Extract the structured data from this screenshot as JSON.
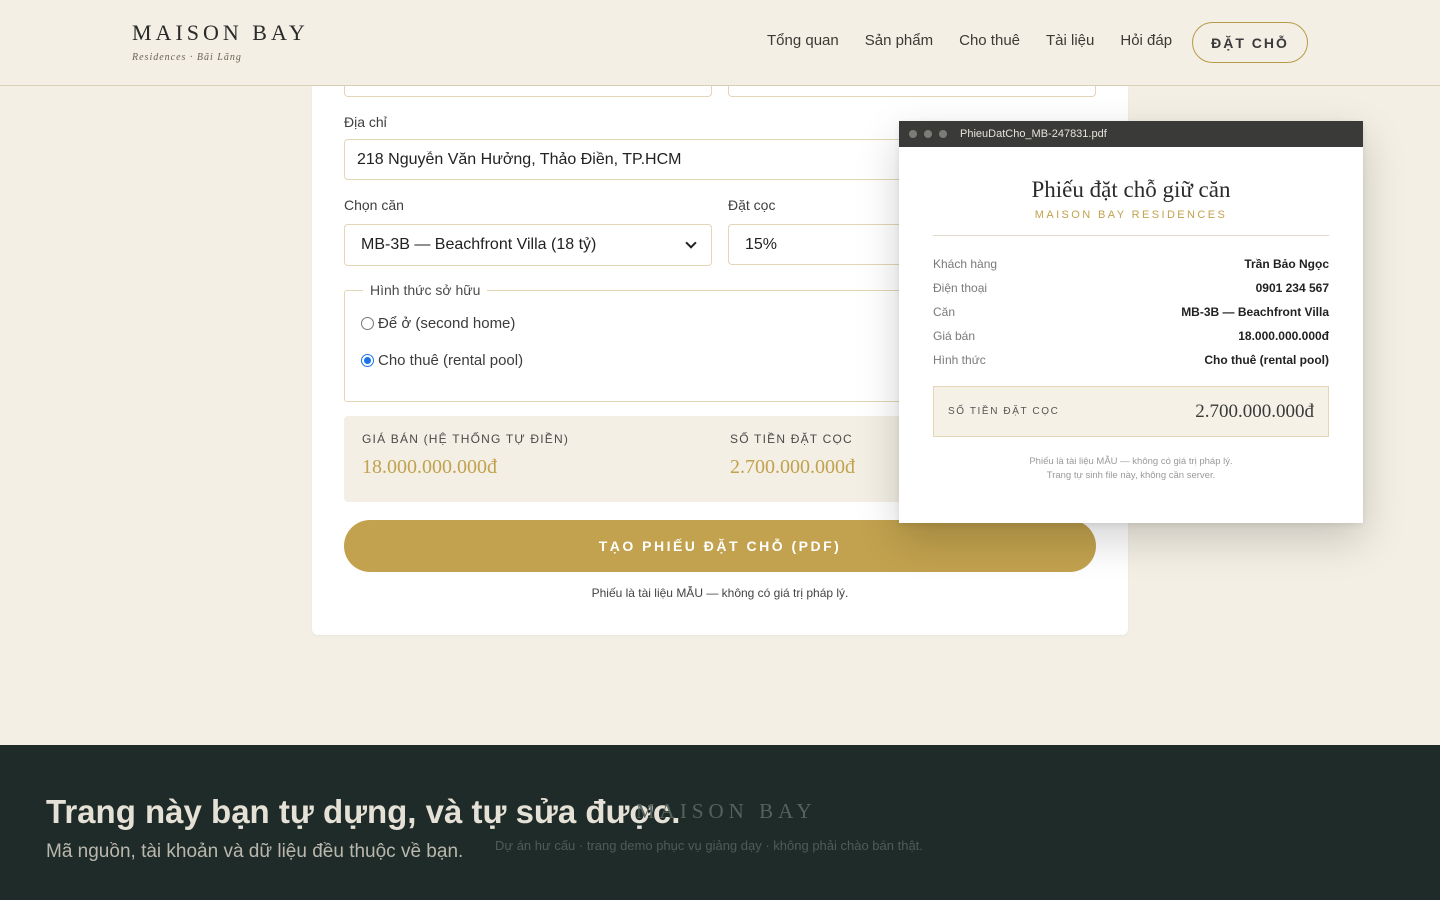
{
  "header": {
    "brand_name": "MAISON BAY",
    "brand_sub": "Residences · Bãi Lãng",
    "nav": [
      "Tổng quan",
      "Sản phẩm",
      "Cho thuê",
      "Tài liệu",
      "Hỏi đáp"
    ],
    "cta_label": "ĐẶT CHỖ"
  },
  "form": {
    "address_label": "Địa chỉ",
    "address_value": "218 Nguyễn Văn Hưởng, Thảo Điền, TP.HCM",
    "unit_label": "Chọn căn",
    "unit_value": "MB-3B — Beachfront Villa (18 tỷ)",
    "deposit_label": "Đặt cọc",
    "deposit_value": "15%",
    "ownership_legend": "Hình thức sở hữu",
    "ownership_options": [
      {
        "label": "Để ở (second home)",
        "checked": false
      },
      {
        "label": "Cho thuê (rental pool)",
        "checked": true
      }
    ],
    "price_label": "GIÁ BÁN (HỆ THỐNG TỰ ĐIỀN)",
    "price_value": "18.000.000.000đ",
    "deposit_amount_label": "SỐ TIỀN ĐẶT CỌC",
    "deposit_amount_value": "2.700.000.000đ",
    "submit_label": "TẠO PHIẾU ĐẶT CHỖ (PDF)",
    "disclaimer": "Phiếu là tài liệu MẪU — không có giá trị pháp lý."
  },
  "pdf": {
    "filename": "PhieuDatCho_MB-247831.pdf",
    "title": "Phiếu đặt chỗ giữ căn",
    "brand": "MAISON BAY RESIDENCES",
    "rows": [
      {
        "k": "Khách hàng",
        "v": "Trần Bảo Ngọc"
      },
      {
        "k": "Điện thoại",
        "v": "0901 234 567"
      },
      {
        "k": "Căn",
        "v": "MB-3B — Beachfront Villa"
      },
      {
        "k": "Giá bán",
        "v": "18.000.000.000đ"
      },
      {
        "k": "Hình thức",
        "v": "Cho thuê (rental pool)"
      }
    ],
    "deposit_label": "SỐ TIỀN ĐẶT CỌC",
    "deposit_value": "2.700.000.000đ",
    "note_1": "Phiếu là tài liệu MẪU — không có giá trị pháp lý.",
    "note_2": "Trang tự sinh file này, không cần server."
  },
  "footer": {
    "headline": "Trang này bạn tự dựng, và tự sửa được.",
    "brand": "MAISON BAY",
    "subline": "Mã nguồn, tài khoản và dữ liệu đều thuộc về bạn.",
    "small": "Dự án hư cấu · trang demo phục vụ giảng dạy · không phải chào bán thật."
  },
  "colors": {
    "background": "#f3efe4",
    "gold": "#c2a24e",
    "footer": "#1f2b28",
    "radio": "#1a73e8"
  }
}
